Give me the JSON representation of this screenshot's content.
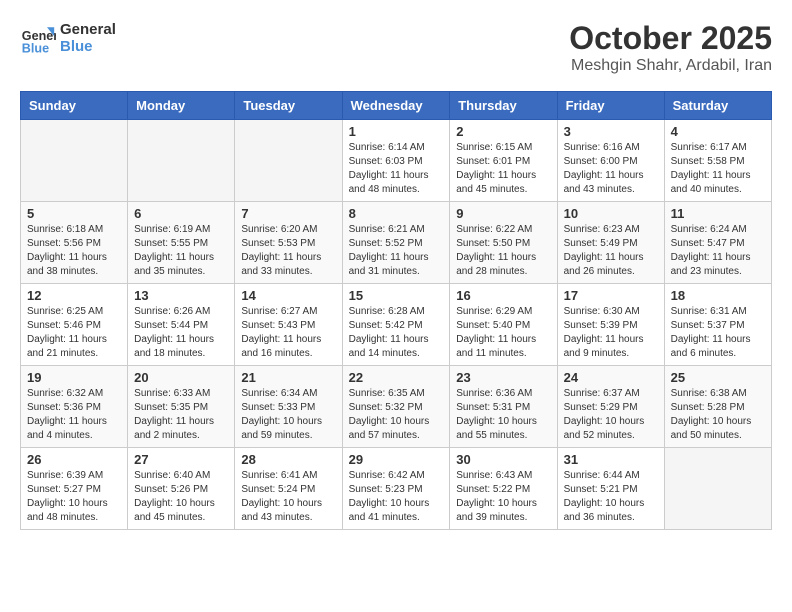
{
  "header": {
    "logo_text_general": "General",
    "logo_text_blue": "Blue",
    "title": "October 2025",
    "subtitle": "Meshgin Shahr, Ardabil, Iran"
  },
  "calendar": {
    "days_of_week": [
      "Sunday",
      "Monday",
      "Tuesday",
      "Wednesday",
      "Thursday",
      "Friday",
      "Saturday"
    ],
    "weeks": [
      [
        {
          "day": "",
          "info": ""
        },
        {
          "day": "",
          "info": ""
        },
        {
          "day": "",
          "info": ""
        },
        {
          "day": "1",
          "info": "Sunrise: 6:14 AM\nSunset: 6:03 PM\nDaylight: 11 hours\nand 48 minutes."
        },
        {
          "day": "2",
          "info": "Sunrise: 6:15 AM\nSunset: 6:01 PM\nDaylight: 11 hours\nand 45 minutes."
        },
        {
          "day": "3",
          "info": "Sunrise: 6:16 AM\nSunset: 6:00 PM\nDaylight: 11 hours\nand 43 minutes."
        },
        {
          "day": "4",
          "info": "Sunrise: 6:17 AM\nSunset: 5:58 PM\nDaylight: 11 hours\nand 40 minutes."
        }
      ],
      [
        {
          "day": "5",
          "info": "Sunrise: 6:18 AM\nSunset: 5:56 PM\nDaylight: 11 hours\nand 38 minutes."
        },
        {
          "day": "6",
          "info": "Sunrise: 6:19 AM\nSunset: 5:55 PM\nDaylight: 11 hours\nand 35 minutes."
        },
        {
          "day": "7",
          "info": "Sunrise: 6:20 AM\nSunset: 5:53 PM\nDaylight: 11 hours\nand 33 minutes."
        },
        {
          "day": "8",
          "info": "Sunrise: 6:21 AM\nSunset: 5:52 PM\nDaylight: 11 hours\nand 31 minutes."
        },
        {
          "day": "9",
          "info": "Sunrise: 6:22 AM\nSunset: 5:50 PM\nDaylight: 11 hours\nand 28 minutes."
        },
        {
          "day": "10",
          "info": "Sunrise: 6:23 AM\nSunset: 5:49 PM\nDaylight: 11 hours\nand 26 minutes."
        },
        {
          "day": "11",
          "info": "Sunrise: 6:24 AM\nSunset: 5:47 PM\nDaylight: 11 hours\nand 23 minutes."
        }
      ],
      [
        {
          "day": "12",
          "info": "Sunrise: 6:25 AM\nSunset: 5:46 PM\nDaylight: 11 hours\nand 21 minutes."
        },
        {
          "day": "13",
          "info": "Sunrise: 6:26 AM\nSunset: 5:44 PM\nDaylight: 11 hours\nand 18 minutes."
        },
        {
          "day": "14",
          "info": "Sunrise: 6:27 AM\nSunset: 5:43 PM\nDaylight: 11 hours\nand 16 minutes."
        },
        {
          "day": "15",
          "info": "Sunrise: 6:28 AM\nSunset: 5:42 PM\nDaylight: 11 hours\nand 14 minutes."
        },
        {
          "day": "16",
          "info": "Sunrise: 6:29 AM\nSunset: 5:40 PM\nDaylight: 11 hours\nand 11 minutes."
        },
        {
          "day": "17",
          "info": "Sunrise: 6:30 AM\nSunset: 5:39 PM\nDaylight: 11 hours\nand 9 minutes."
        },
        {
          "day": "18",
          "info": "Sunrise: 6:31 AM\nSunset: 5:37 PM\nDaylight: 11 hours\nand 6 minutes."
        }
      ],
      [
        {
          "day": "19",
          "info": "Sunrise: 6:32 AM\nSunset: 5:36 PM\nDaylight: 11 hours\nand 4 minutes."
        },
        {
          "day": "20",
          "info": "Sunrise: 6:33 AM\nSunset: 5:35 PM\nDaylight: 11 hours\nand 2 minutes."
        },
        {
          "day": "21",
          "info": "Sunrise: 6:34 AM\nSunset: 5:33 PM\nDaylight: 10 hours\nand 59 minutes."
        },
        {
          "day": "22",
          "info": "Sunrise: 6:35 AM\nSunset: 5:32 PM\nDaylight: 10 hours\nand 57 minutes."
        },
        {
          "day": "23",
          "info": "Sunrise: 6:36 AM\nSunset: 5:31 PM\nDaylight: 10 hours\nand 55 minutes."
        },
        {
          "day": "24",
          "info": "Sunrise: 6:37 AM\nSunset: 5:29 PM\nDaylight: 10 hours\nand 52 minutes."
        },
        {
          "day": "25",
          "info": "Sunrise: 6:38 AM\nSunset: 5:28 PM\nDaylight: 10 hours\nand 50 minutes."
        }
      ],
      [
        {
          "day": "26",
          "info": "Sunrise: 6:39 AM\nSunset: 5:27 PM\nDaylight: 10 hours\nand 48 minutes."
        },
        {
          "day": "27",
          "info": "Sunrise: 6:40 AM\nSunset: 5:26 PM\nDaylight: 10 hours\nand 45 minutes."
        },
        {
          "day": "28",
          "info": "Sunrise: 6:41 AM\nSunset: 5:24 PM\nDaylight: 10 hours\nand 43 minutes."
        },
        {
          "day": "29",
          "info": "Sunrise: 6:42 AM\nSunset: 5:23 PM\nDaylight: 10 hours\nand 41 minutes."
        },
        {
          "day": "30",
          "info": "Sunrise: 6:43 AM\nSunset: 5:22 PM\nDaylight: 10 hours\nand 39 minutes."
        },
        {
          "day": "31",
          "info": "Sunrise: 6:44 AM\nSunset: 5:21 PM\nDaylight: 10 hours\nand 36 minutes."
        },
        {
          "day": "",
          "info": ""
        }
      ]
    ]
  }
}
